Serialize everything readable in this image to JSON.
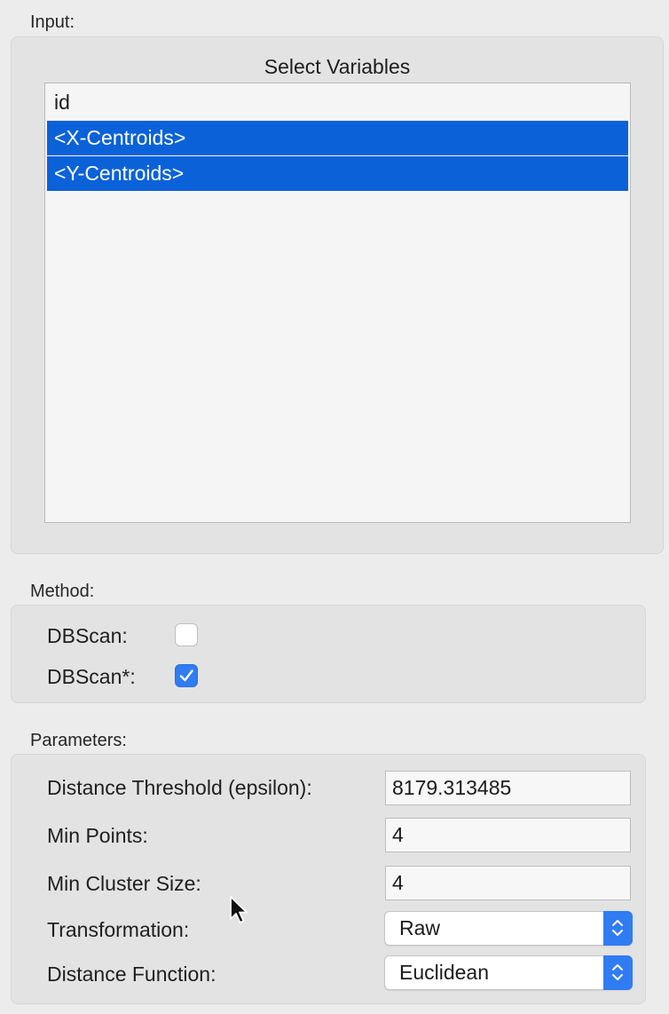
{
  "input": {
    "label": "Input:",
    "list_title": "Select Variables",
    "variables": [
      {
        "label": "id",
        "selected": false
      },
      {
        "label": "<X-Centroids>",
        "selected": true
      },
      {
        "label": "<Y-Centroids>",
        "selected": true
      }
    ]
  },
  "method": {
    "label": "Method:",
    "dbscan": {
      "label": "DBScan:",
      "checked": false
    },
    "dbscan_star": {
      "label": "DBScan*:",
      "checked": true
    }
  },
  "parameters": {
    "label": "Parameters:",
    "distance_threshold": {
      "label": "Distance Threshold (epsilon):",
      "value": "8179.313485"
    },
    "min_points": {
      "label": "Min Points:",
      "value": "4"
    },
    "min_cluster_size": {
      "label": "Min Cluster Size:",
      "value": "4"
    },
    "transformation": {
      "label": "Transformation:",
      "value": "Raw"
    },
    "distance_function": {
      "label": "Distance Function:",
      "value": "Euclidean"
    }
  },
  "colors": {
    "selection": "#0b62d8",
    "accent": "#2f7cf3"
  }
}
